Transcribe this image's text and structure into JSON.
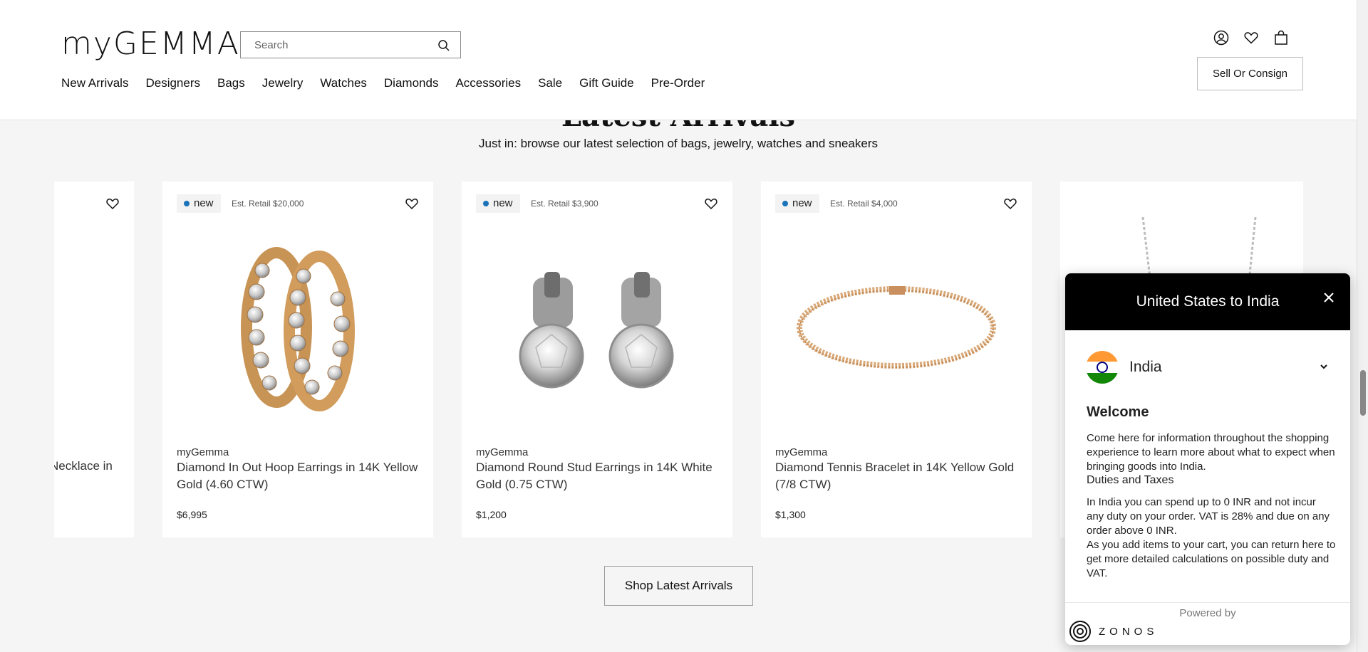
{
  "brand": {
    "logo_text": "myGEMMA"
  },
  "search": {
    "placeholder": "Search"
  },
  "nav": [
    "New Arrivals",
    "Designers",
    "Bags",
    "Jewelry",
    "Watches",
    "Diamonds",
    "Accessories",
    "Sale",
    "Gift Guide",
    "Pre-Order"
  ],
  "header": {
    "sell_label": "Sell Or Consign",
    "icons": [
      "account-icon",
      "heart-icon",
      "bag-icon"
    ]
  },
  "section": {
    "title": "Latest Arrivals",
    "subtitle": "Just in: browse our latest selection of bags, jewelry, watches and sneakers",
    "button_label": "Shop Latest Arrivals"
  },
  "left_card": {
    "name_fragment": "Necklace in"
  },
  "cards": [
    {
      "tag": "new",
      "retail": "Est. Retail $20,000",
      "brand": "myGemma",
      "name": "Diamond In Out Hoop Earrings in 14K Yellow Gold (4.60 CTW)",
      "price": "$6,995",
      "image": "hoop-earrings"
    },
    {
      "tag": "new",
      "retail": "Est. Retail $3,900",
      "brand": "myGemma",
      "name": "Diamond Round Stud Earrings in 14K White Gold (0.75 CTW)",
      "price": "$1,200",
      "image": "stud-earrings"
    },
    {
      "tag": "new",
      "retail": "Est. Retail $4,000",
      "brand": "myGemma",
      "name": "Diamond Tennis Bracelet in 14K Yellow Gold (7/8 CTW)",
      "price": "$1,300",
      "image": "tennis-bracelet"
    }
  ],
  "modal": {
    "title": "United States to India",
    "country": "India",
    "welcome": "Welcome",
    "welcome_text": "Come here for information throughout the shopping experience to learn more about what to expect when bringing goods into India.",
    "duties_heading": "Duties and Taxes",
    "duties_text": "In India you can spend up to 0 INR and not incur any duty on your order. VAT is 28% and due on any order above 0 INR.",
    "cart_text": "As you add items to your cart, you can return here to get more detailed calculations on possible duty and VAT.",
    "powered_by": "Powered by",
    "powered_brand": "ZONOS"
  },
  "colors": {
    "accent_dot": "#1a73b8",
    "modal_header": "#000000"
  }
}
